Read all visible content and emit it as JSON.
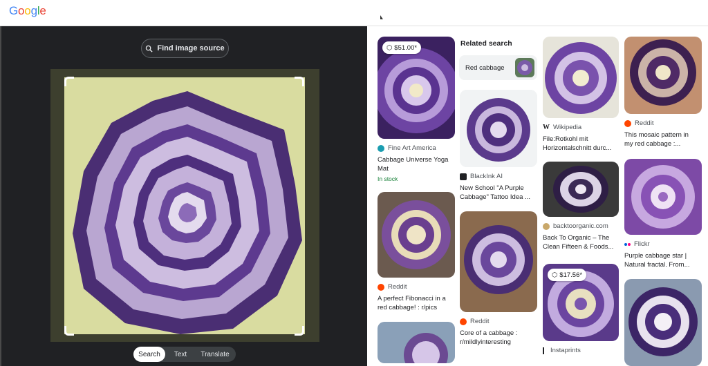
{
  "header": {
    "logo_letters": [
      {
        "ch": "G",
        "color": "#4285F4"
      },
      {
        "ch": "o",
        "color": "#EA4335"
      },
      {
        "ch": "o",
        "color": "#FBBC05"
      },
      {
        "ch": "g",
        "color": "#4285F4"
      },
      {
        "ch": "l",
        "color": "#34A853"
      },
      {
        "ch": "e",
        "color": "#EA4335"
      }
    ]
  },
  "viewer": {
    "find_source_label": "Find image source",
    "find_source_icon": "lens-search-icon",
    "modes": [
      "Search",
      "Text",
      "Translate"
    ],
    "active_mode": "Search"
  },
  "results": {
    "related_search_heading": "Related search",
    "related_chip_label": "Red cabbage",
    "cards": [
      {
        "price": "$51.00*",
        "source": "Fine Art America",
        "title": "Cabbage Universe Yoga\nMat",
        "stock": "In stock",
        "source_icon_color": "#1a9db0"
      },
      {
        "source": "Reddit",
        "title": "A perfect Fibonacci in a\nred cabbage! : r/pics",
        "source_icon_color": "#ff4500"
      },
      {
        "source": "BlackInk AI",
        "title": "New School \"A Purple\nCabbage\" Tattoo Idea ...",
        "source_icon_color": "#202124"
      },
      {
        "source": "Reddit",
        "title": "Core of a cabbage :\nr/mildlyinteresting",
        "source_icon_color": "#ff4500"
      },
      {
        "source": "Wikipedia",
        "title": "File:Rotkohl mit\nHorizontalschnitt durc...",
        "source_icon_color": "#202124"
      },
      {
        "source": "backtoorganic.com",
        "title": "Back To Organic – The\nClean Fifteen & Foods...",
        "source_icon_color": "#c9a86a"
      },
      {
        "price": "$17.56*",
        "source": "Instaprints",
        "source_icon_color": "#202124"
      },
      {
        "source": "Reddit",
        "title": "This mosaic pattern in\nmy red cabbage :...",
        "source_icon_color": "#ff4500"
      },
      {
        "source": "Flickr",
        "title": "Purple cabbage star |\nNatural fractal. From...",
        "source_icon_color": "#0063dc"
      }
    ]
  },
  "colors": {
    "cabbage_purple": "#5b3a8c",
    "cabbage_light": "#c9b8dd",
    "accent_green": "#188038"
  }
}
